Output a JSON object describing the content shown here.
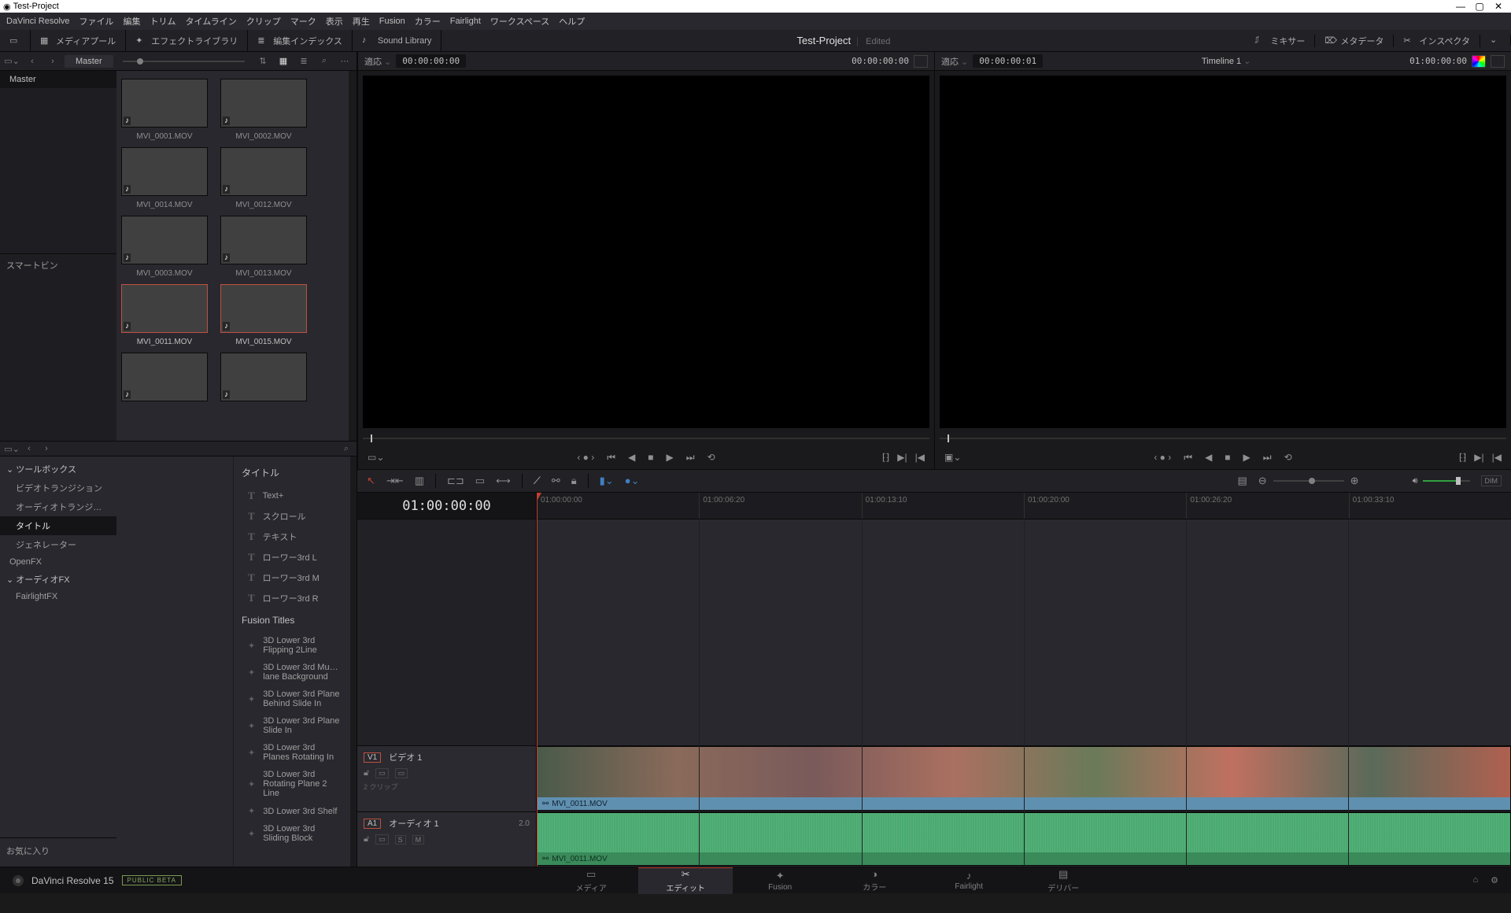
{
  "window": {
    "title": "Test-Project"
  },
  "menus": [
    "DaVinci Resolve",
    "ファイル",
    "編集",
    "トリム",
    "タイムライン",
    "クリップ",
    "マーク",
    "表示",
    "再生",
    "Fusion",
    "カラー",
    "Fairlight",
    "ワークスペース",
    "ヘルプ"
  ],
  "toolbar": {
    "media_pool": "メディアプール",
    "effects_lib": "エフェクトライブラリ",
    "edit_index": "編集インデックス",
    "sound_lib": "Sound Library",
    "project": "Test-Project",
    "edited": "Edited",
    "mixer": "ミキサー",
    "metadata": "メタデータ",
    "inspector": "インスペクタ"
  },
  "media": {
    "master": "Master",
    "tree_master": "Master",
    "smartbin": "スマートビン",
    "clips": [
      {
        "name": "MVI_0001.MOV",
        "tint": "t1"
      },
      {
        "name": "MVI_0002.MOV",
        "tint": "t2"
      },
      {
        "name": "MVI_0014.MOV",
        "tint": "t3"
      },
      {
        "name": "MVI_0012.MOV",
        "tint": "t4"
      },
      {
        "name": "MVI_0003.MOV",
        "tint": "t5"
      },
      {
        "name": "MVI_0013.MOV",
        "tint": "t6"
      },
      {
        "name": "MVI_0011.MOV",
        "tint": "t7",
        "selected": true
      },
      {
        "name": "MVI_0015.MOV",
        "tint": "t8",
        "selected": true
      },
      {
        "name": "",
        "tint": "t9",
        "partial": true
      },
      {
        "name": "",
        "tint": "t10",
        "partial": true
      }
    ]
  },
  "effects": {
    "tree": [
      {
        "label": "ツールボックス",
        "header": true
      },
      {
        "label": "ビデオトランジション"
      },
      {
        "label": "オーディオトランジ…"
      },
      {
        "label": "タイトル",
        "active": true
      },
      {
        "label": "ジェネレーター"
      },
      {
        "label": "OpenFX",
        "plain": true
      },
      {
        "label": "オーディオFX",
        "header": true
      },
      {
        "label": "FairlightFX"
      }
    ],
    "favorites": "お気に入り",
    "section_title": "タイトル",
    "titles": [
      "Text+",
      "スクロール",
      "テキスト",
      "ローワー3rd L",
      "ローワー3rd M",
      "ローワー3rd R"
    ],
    "section_fusion": "Fusion Titles",
    "fusion": [
      "3D Lower 3rd Flipping 2Line",
      "3D Lower 3rd Mu…lane Background",
      "3D Lower 3rd Plane Behind Slide In",
      "3D Lower 3rd Plane Slide In",
      "3D Lower 3rd Planes Rotating In",
      "3D Lower 3rd Rotating Plane 2 Line",
      "3D Lower 3rd Shelf",
      "3D Lower 3rd Sliding Block"
    ]
  },
  "viewer_src": {
    "fit": "適応",
    "tc_in": "00:00:00:00",
    "tc_right": "00:00:00:00"
  },
  "viewer_rec": {
    "fit": "適応",
    "tc_in": "00:00:00:01",
    "name": "Timeline 1",
    "tc_right": "01:00:00:00"
  },
  "timeline": {
    "tc": "01:00:00:00",
    "ruler": [
      "01:00:00:00",
      "01:00:06:20",
      "01:00:13:10",
      "01:00:20:00",
      "01:00:26:20",
      "01:00:33:10"
    ],
    "video": {
      "badge": "V1",
      "name": "ビデオ 1",
      "meta": "2 クリップ",
      "clip": "MVI_0011.MOV"
    },
    "audio": {
      "badge": "A1",
      "name": "オーディオ 1",
      "ch": "2.0",
      "s": "S",
      "m": "M",
      "clip": "MVI_0011.MOV"
    }
  },
  "toolbar_tl": {
    "dim": "DIM"
  },
  "bottom": {
    "app": "DaVinci Resolve 15",
    "beta": "PUBLIC BETA",
    "pages": [
      {
        "label": "メディア",
        "icon": "▭"
      },
      {
        "label": "エディット",
        "icon": "✂",
        "active": true
      },
      {
        "label": "Fusion",
        "icon": "✦"
      },
      {
        "label": "カラー",
        "icon": "◑"
      },
      {
        "label": "Fairlight",
        "icon": "♪"
      },
      {
        "label": "デリバー",
        "icon": "▤"
      }
    ]
  }
}
